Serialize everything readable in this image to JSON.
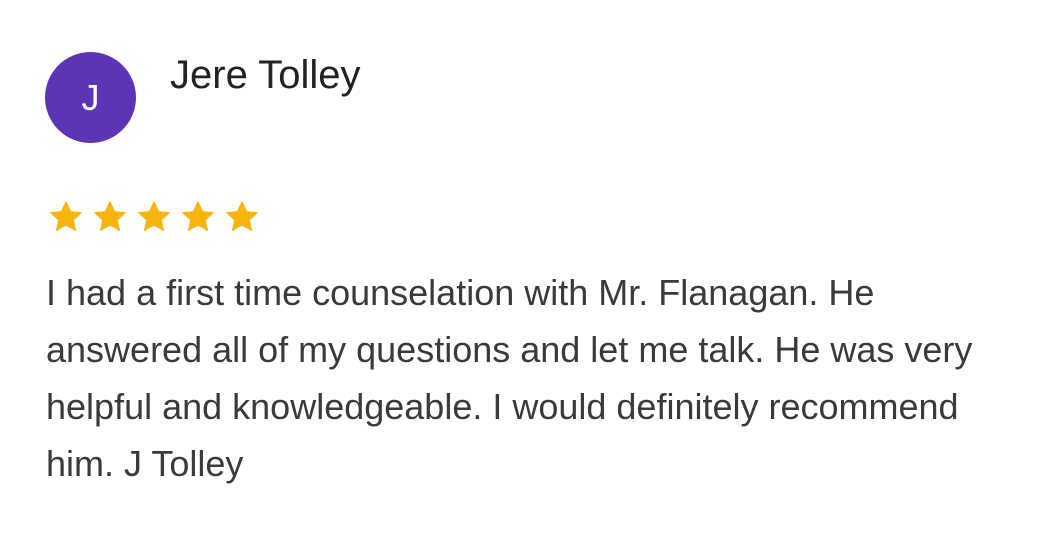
{
  "reviewer": {
    "initial": "J",
    "name": "Jere Tolley",
    "avatar_color": "#5b35b5"
  },
  "rating": {
    "value": 5,
    "max": 5,
    "star_color": "#f6b40e",
    "icon": "star-icon"
  },
  "review": {
    "text": "I had a first time counselation with Mr. Flanagan. He answered all of my questions and let me talk. He was very helpful and knowledgeable. I would definitely recommend him. J Tolley"
  }
}
